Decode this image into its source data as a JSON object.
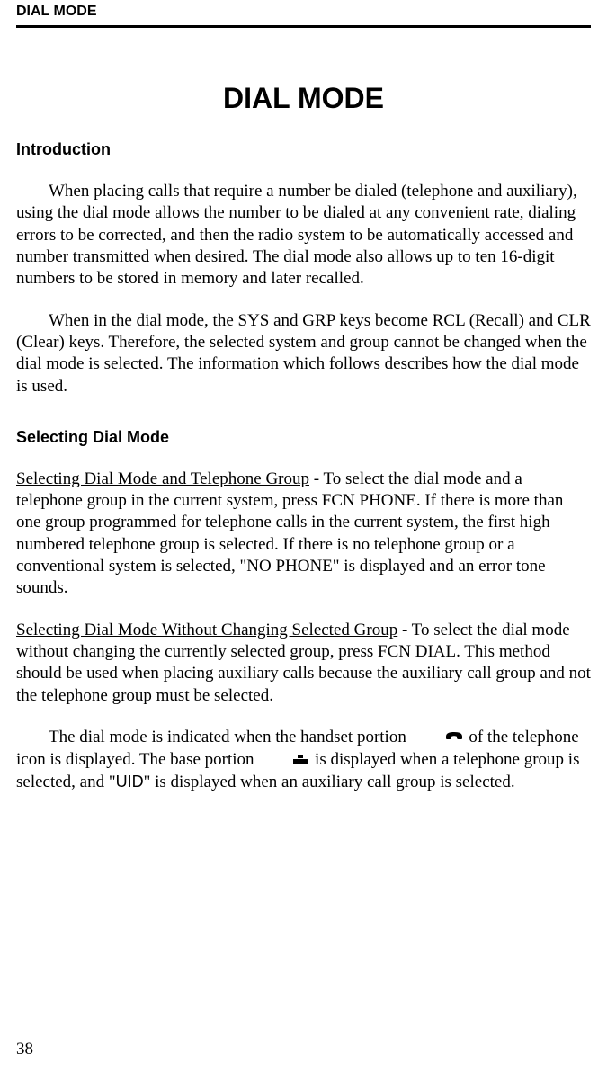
{
  "header": {
    "running": "DIAL MODE"
  },
  "title": "DIAL MODE",
  "sections": {
    "intro": {
      "heading": "Introduction",
      "p1": "When placing calls that require a number be dialed (telephone and auxiliary), using the dial mode allows the number to be dialed at any convenient rate, dialing errors to be corrected, and then the radio system to be automatically accessed and number transmitted when desired. The dial mode also allows up to ten 16-digit numbers to be stored in memory and later recalled.",
      "p2": "When in the dial mode, the SYS and GRP keys become RCL (Recall) and CLR (Clear) keys. Therefore, the selected system and group cannot be changed when the dial mode is selected. The information which follows describes how the dial mode is used."
    },
    "select": {
      "heading": "Selecting Dial Mode",
      "p1_lead": "Selecting Dial Mode and Telephone Group",
      "p1_rest": " - To select the dial mode and a telephone group in the current system, press FCN PHONE. If there is more than one group programmed for telephone calls in the current system, the first high numbered telephone group is selected. If there is no telephone group or a conventional system is selected, \"NO PHONE\" is displayed and an error tone sounds.",
      "p2_lead": "Selecting Dial Mode Without Changing Selected Group",
      "p2_rest": " - To select the dial mode without changing the currently selected group, press FCN DIAL. This method should be used when placing auxiliary calls because the auxiliary call group and not the telephone group must be selected.",
      "p3_a": "The dial mode is indicated when the handset portion ",
      "p3_b": " of the tele­phone icon is displayed. The base portion ",
      "p3_c": " is displayed when a tele­phone group is selected, and \"",
      "p3_uid": "UID",
      "p3_d": "\" is displayed when an auxiliary call group is selected."
    }
  },
  "page": "38"
}
